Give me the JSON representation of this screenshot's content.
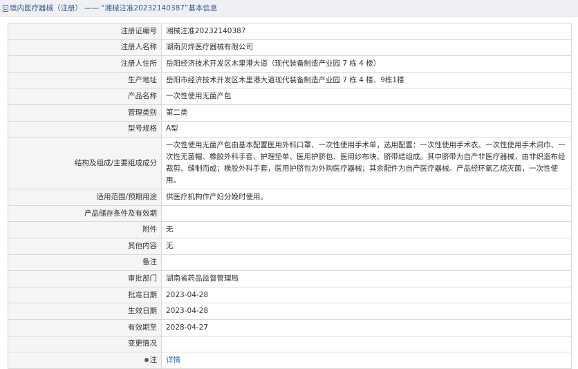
{
  "breadcrumb": {
    "section": "境内医疗器械（注册）",
    "separator": "——",
    "record": "“湘械注准20232140387”",
    "page": "基本信息"
  },
  "rows": [
    {
      "label": "注册证编号",
      "value": "湘械注准20232140387"
    },
    {
      "label": "注册人名称",
      "value": "湖南贝烨医疗器械有限公司"
    },
    {
      "label": "注册人住所",
      "value": "岳阳经济技术开发区木里港大道（现代装备制造产业园 7 栋 4 楼）"
    },
    {
      "label": "生产地址",
      "value": "岳阳市经济技术开发区木里港大道现代装备制造产业园 7 栋 4 楼、9栋1楼"
    },
    {
      "label": "产品名称",
      "value": "一次性使用无菌产包"
    },
    {
      "label": "管理类别",
      "value": "第二类"
    },
    {
      "label": "型号规格",
      "value": "A型"
    },
    {
      "label": "结构及组成/主要组成成分",
      "value": "一次性使用无菌产包由基本配置医用外科口罩、一次性使用手术单，选用配置：一次性使用手术衣、一次性使用手术洞巾、一次性无菌帽、橡胶外科手套、护理垫单、医用护脐包、医用纱布块、脐带结组成。其中脐带为自产非医疗器械，由非织造布经裁剪、缝制而成；橡胶外科手套，医用护脐包为外购医疗器械；其余配件为自产医疗器械。产品经环氧乙烷灭菌，一次性使用。"
    },
    {
      "label": "适用范围/预期用途",
      "value": "供医疗机构作产妇分娩时使用。"
    },
    {
      "label": "产品储存条件及有效期",
      "value": ""
    },
    {
      "label": "附件",
      "value": "无"
    },
    {
      "label": "其他内容",
      "value": "无"
    },
    {
      "label": "备注",
      "value": ""
    },
    {
      "label": "审批部门",
      "value": "湖南省药品监督管理局"
    },
    {
      "label": "批准日期",
      "value": "2023-04-28"
    },
    {
      "label": "生效日期",
      "value": "2023-04-28"
    },
    {
      "label": "有效期至",
      "value": "2028-04-27"
    },
    {
      "label": "变更情况",
      "value": ""
    }
  ],
  "footer_row": {
    "label": "注",
    "link": "详情",
    "icon": "bullet-icon"
  }
}
